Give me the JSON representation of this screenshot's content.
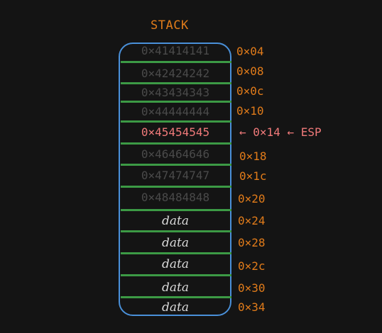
{
  "title": "STACK",
  "cells": [
    {
      "value": "0×41414141",
      "kind": "hex",
      "address": "0×04"
    },
    {
      "value": "0×42424242",
      "kind": "hex",
      "address": "0×08"
    },
    {
      "value": "0×43434343",
      "kind": "hex",
      "address": "0×0c"
    },
    {
      "value": "0×44444444",
      "kind": "hex",
      "address": "0×10"
    },
    {
      "value": "0×45454545",
      "kind": "hex",
      "address": "0×14",
      "active": true
    },
    {
      "value": "0×46464646",
      "kind": "hex",
      "address": "0×18"
    },
    {
      "value": "0×47474747",
      "kind": "hex",
      "address": "0×1c"
    },
    {
      "value": "0×48484848",
      "kind": "hex",
      "address": "0×20"
    },
    {
      "value": "data",
      "kind": "data",
      "address": "0×24"
    },
    {
      "value": "data",
      "kind": "data",
      "address": "0×28"
    },
    {
      "value": "data",
      "kind": "data",
      "address": "0×2c"
    },
    {
      "value": "data",
      "kind": "data",
      "address": "0×30"
    },
    {
      "value": "data",
      "kind": "data",
      "address": "0×34"
    }
  ],
  "pointer": {
    "arrow1": "←",
    "address": "0×14",
    "arrow2": "←",
    "register": "ESP"
  },
  "colors": {
    "background": "#141414",
    "accent_orange": "#e07b1a",
    "box_blue": "#4a90d9",
    "divider_green": "#3c9a45",
    "active_red": "#f07a7a",
    "inactive_hex": "#4a4a4a",
    "data_text": "#d8d8d8"
  }
}
